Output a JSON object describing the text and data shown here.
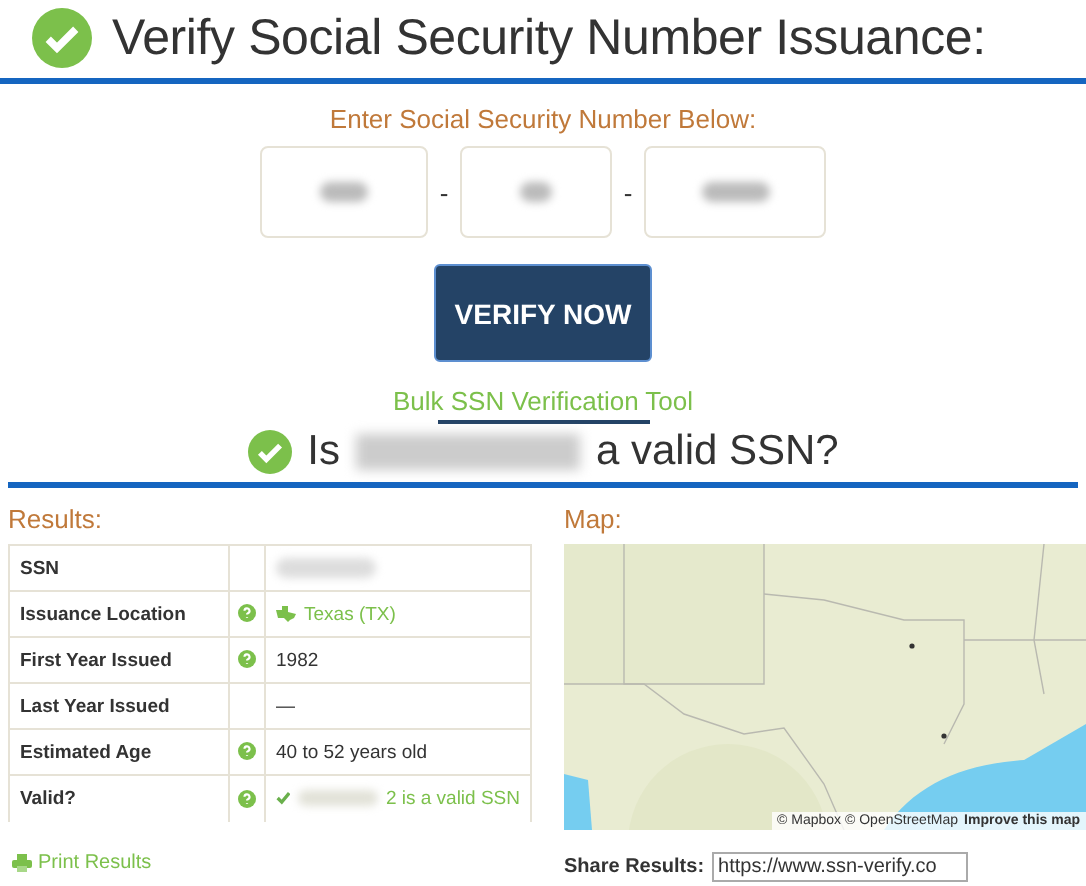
{
  "header": {
    "title": "Verify Social Security Number Issuance:"
  },
  "form": {
    "prompt": "Enter Social Security Number Below:",
    "separators": [
      "-",
      "-"
    ],
    "button": "VERIFY NOW",
    "link": "Bulk SSN Verification Tool"
  },
  "verdict": {
    "before": "Is",
    "after": "a valid SSN?"
  },
  "results": {
    "heading": "Results:",
    "rows": [
      {
        "label": "SSN",
        "help": false,
        "kind": "redacted"
      },
      {
        "label": "Issuance Location",
        "help": true,
        "kind": "location",
        "value": "Texas (TX)"
      },
      {
        "label": "First Year Issued",
        "help": true,
        "kind": "text",
        "value": "1982"
      },
      {
        "label": "Last Year Issued",
        "help": false,
        "kind": "text",
        "value": "—"
      },
      {
        "label": "Estimated Age",
        "help": true,
        "kind": "text",
        "value": "40 to 52 years old"
      },
      {
        "label": "Valid?",
        "help": true,
        "kind": "valid",
        "value": "2 is a valid SSN"
      }
    ],
    "print": "Print Results"
  },
  "map": {
    "heading": "Map:",
    "attribution": "© Mapbox © OpenStreetMap",
    "improve": "Improve this map"
  },
  "share": {
    "label": "Share Results:",
    "value": "https://www.ssn-verify.co"
  }
}
